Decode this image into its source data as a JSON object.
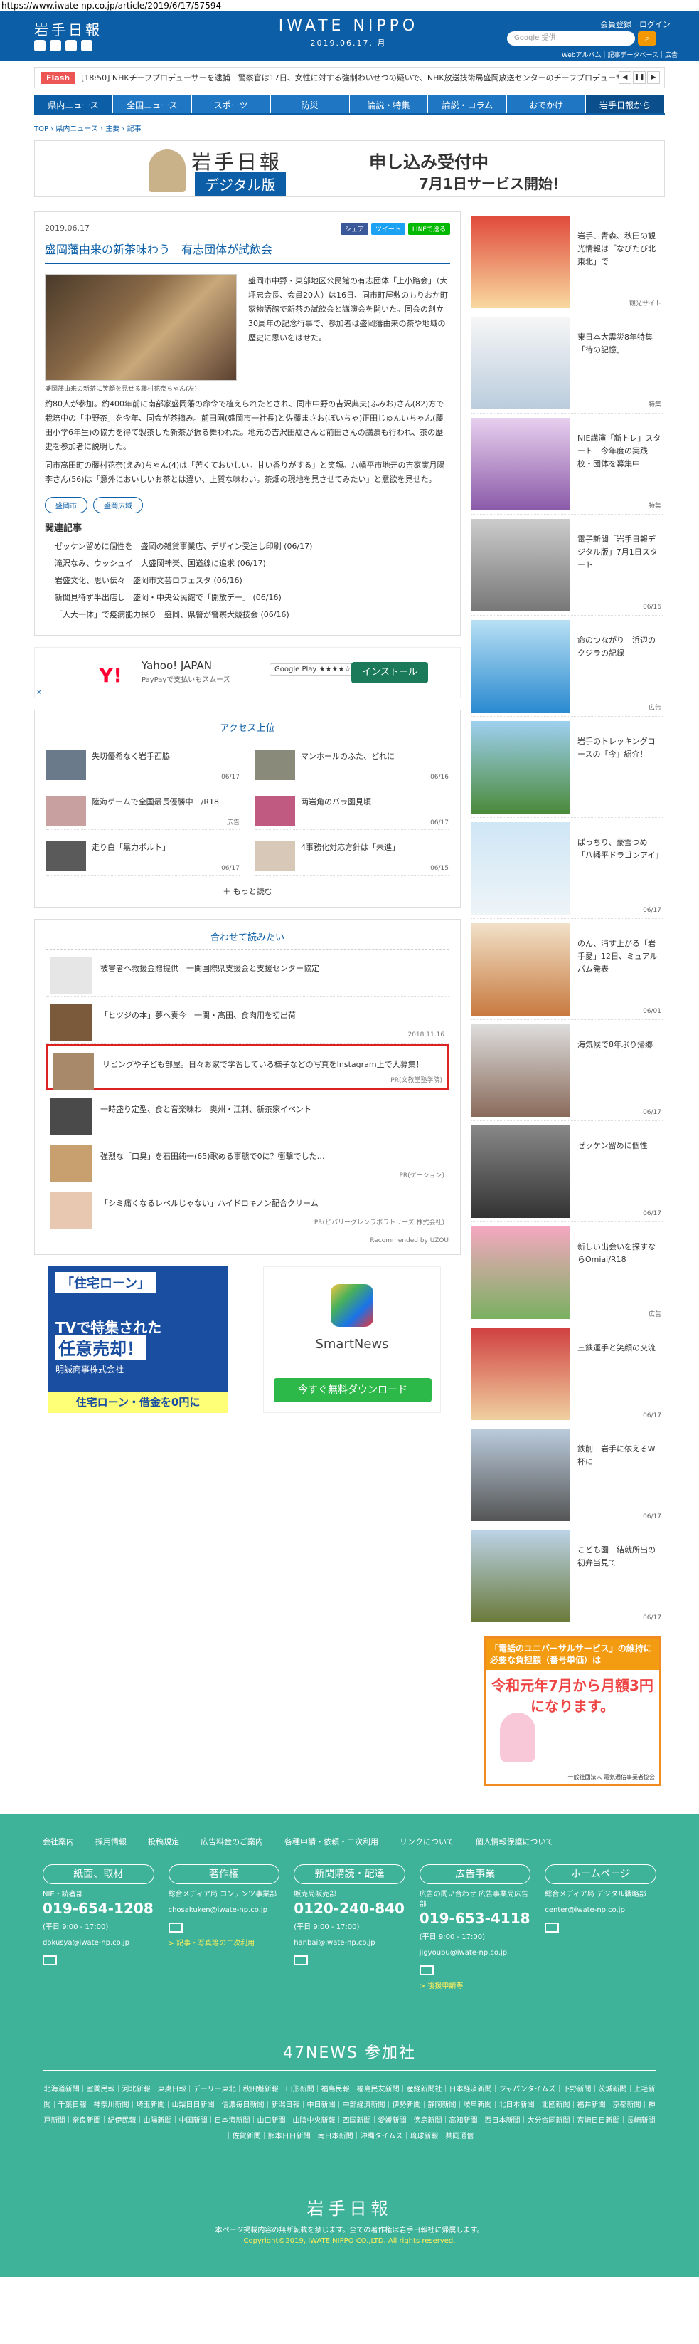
{
  "url": "https://www.iwate-np.co.jp/article/2019/6/17/57594",
  "header": {
    "logo_text": "岩手日報",
    "center_logo": "IWATE NIPPO",
    "center_date": "2019.06.17. 月",
    "member_links": "会員登録　ログイン",
    "search_placeholder": "Google 提供",
    "sublinks": "Webアルバム｜記事データベース｜広告"
  },
  "flash": {
    "label": "Flash",
    "text": "[18:50] NHKチーフプロデューサーを逮捕　警察官は17日、女性に対する強制わいせつの疑いで、NHK放送技術局盛岡放送センターのチーフプロデューサー..."
  },
  "nav": [
    "県内ニュース",
    "全国ニュース",
    "スポーツ",
    "防災",
    "論説・特集",
    "論説・コラム",
    "おでかけ",
    "岩手日報から"
  ],
  "breadcrumb": "TOP › 県内ニュース › 主要 › 記事",
  "banner": {
    "logo": "岩手日報",
    "digital": "デジタル版",
    "line1": "申し込み受付中",
    "line2": "7月1日サービス開始！"
  },
  "article": {
    "date": "2019.06.17",
    "share": [
      "シェア",
      "ツイート",
      "LINEで送る"
    ],
    "title": "盛岡藩由来の新茶味わう　有志団体が試飲会",
    "caption": "盛岡藩由来の新茶に笑顔を見せる藤村花奈ちゃん(左)",
    "p1": "盛岡市中野・東部地区公民館の有志団体「上小路会」（大坪忠会長、会員20人）は16日、同市町屋敷のもりおか町家物語館で新茶の試飲会と講演会を開いた。同会の創立30周年の記念行事で、参加者は盛岡藩由来の茶や地域の歴史に思いをはせた。",
    "p2": "約80人が参加。約400年前に南部家盛岡藩の命令で植えられたとされ、同市中野の吉沢典夫(ふみお)さん(82)方で栽培中の「中野茶」を今年、同会が茶摘み。前田園(盛岡市一社長)と佐藤まさお(ぼいちゃ)正田じゅんいちゃん(藤田小学6年生)の協力を得て製茶した新茶が振る舞われた。地元の吉沢田紘さんと前田さんの講演も行われ、茶の歴史を参加者に説明した。",
    "p3": "同市高田町の藤村花奈(えみ)ちゃん(4)は「苦くておいしい。甘い香りがする」と笑顔。八幡平市地元の吉家実月陽李さん(56)は「意外においしいお茶とは違い、上質な味わい。茶畑の現地を見させてみたい」と意欲を見せた。",
    "tags": [
      "盛岡市",
      "盛岡広域"
    ],
    "related_title": "関連記事",
    "related": [
      "ゼッケン留めに個性を　盛岡の雑貨事業店、デザイン受注し印刷 (06/17)",
      "滝沢なみ、ウッシュイ　大盛岡神楽、国道線に追求 (06/17)",
      "岩盛文化、思い伝々　盛岡市文芸ロフェスタ (06/16)",
      "新聞見待ず半出店し　盛岡・中央公民館で「開放デー」 (06/16)",
      "「人大一体」で疫病能力探り　盛岡、県警が警察犬競技会 (06/16)"
    ]
  },
  "ad_yahoo": {
    "brand": "Yahoo! JAPAN",
    "sub": "PayPayで支払いもスムーズ",
    "store": "Google Play ★★★★☆",
    "button": "インストール",
    "x": "×"
  },
  "ranking": {
    "title": "アクセス上位",
    "items": [
      {
        "text": "失切優希なく岩手西脇",
        "date": "06/17"
      },
      {
        "text": "マンホールのふた、どれに",
        "date": "06/16"
      },
      {
        "text": "陸海ゲームで全国最長優勝中　/R18",
        "date": "広告"
      },
      {
        "text": "两岩角のバラ園見頃",
        "date": "06/17"
      },
      {
        "text": "走り白「黒力ボルト」",
        "date": "06/17"
      },
      {
        "text": "4事務化対応方針は「未進」",
        "date": "06/15"
      }
    ],
    "more": "＋ もっと読む"
  },
  "recommend": {
    "title": "合わせて読みたい",
    "items": [
      {
        "text": "被害者へ救援金贈提供　一関国際県支援会と支援センター協定",
        "src": ""
      },
      {
        "text": "「ヒツジの本」夢へ奏今　一関・高田、食肉用を初出荷",
        "src": "2018.11.16"
      },
      {
        "text": "リビングや子ども部屋。日々お家で学習している様子などの写真をInstagram上で大募集！",
        "src": "PR(文教堂塾学院)"
      },
      {
        "text": "一時盛り定型、食と音楽味わ　奥州・江刺、新茶家イベント",
        "src": ""
      },
      {
        "text": "強烈な「口臭」を石田純一(65)歌める事態で0に？衝撃でした…",
        "src": "PR(ゲーション)"
      },
      {
        "text": "「シミ痛くなるレベルじゃない」ハイドロキノン配合クリーム",
        "src": "PR(ビバリーグレンラボラトリーズ 株式会社)"
      }
    ],
    "by": "Recommended by UZOU"
  },
  "ad_loan": {
    "l1": "「住宅ローン」",
    "l2": "TVで特集された",
    "l3": "任意売却！",
    "l4": "明誠商事株式会社",
    "l5": "住宅ローン・借金を0円に"
  },
  "ad_smart": {
    "name": "SmartNews",
    "button": "今すぐ無料ダウンロード"
  },
  "side": [
    {
      "text": "岩手、青森、秋田の観光情報は「なびたび北東北」で",
      "src": "観光サイト"
    },
    {
      "text": "東日本大震災8年特集「待の記憶」",
      "src": "特集"
    },
    {
      "text": "NIE講演「新トレ」スタート　今年度の実践校・団体を募集中",
      "src": "特集"
    },
    {
      "text": "電子新聞「岩手日報デジタル版」7月1日スタート",
      "src": "06/16"
    },
    {
      "text": "命のつながり　浜辺のクジラの記録",
      "src": "広告"
    },
    {
      "text": "岩手のトレッキングコースの「今」紹介！",
      "src": ""
    },
    {
      "text": "ぱっちり、豪雪つめ「八幡平ドラゴンアイ」",
      "src": "06/17"
    },
    {
      "text": "のん、消す上がる「岩手愛」12日、ミュアルバム発表",
      "src": "06/01"
    },
    {
      "text": "海気候で8年ぶり帰郷",
      "src": "06/17"
    },
    {
      "text": "ゼッケン留めに個性",
      "src": "06/17"
    },
    {
      "text": "新しい出会いを探すならOmiai/R18",
      "src": "広告"
    },
    {
      "text": "三鉄運手と笑顔の交流",
      "src": "06/17"
    },
    {
      "text": "鉄削　岩手に依えるW杯に",
      "src": "06/17"
    },
    {
      "text": "こども園　結就所出の初弁当見て",
      "src": "06/17"
    }
  ],
  "side_ad": {
    "head": "「電話のユニバーサルサービス」の維持に必要な負担額（番号単価）は",
    "big": "令和元年7月から月額3円になります。",
    "foot": "一般社団法人 電気通信事業者協会"
  },
  "footer": {
    "links": [
      "会社案内",
      "採用情報",
      "投稿規定",
      "広告料金のご案内",
      "各種申請・依頼・二次利用",
      "リンクについて",
      "個人情報保護について"
    ],
    "boxes": [
      {
        "head": "紙面、取材",
        "dept": "NIE・読者部",
        "phone": "019-654-1208",
        "hours": "(平日 9:00 - 17:00)",
        "mail": "dokusya@iwate-np.co.jp",
        "link": ""
      },
      {
        "head": "著作権",
        "dept": "総合メディア局 コンテンツ事業部",
        "phone": "",
        "hours": "",
        "mail": "chosakuken@iwate-np.co.jp",
        "link": "> 記事・写真等の二次利用"
      },
      {
        "head": "新聞購読・配達",
        "dept": "販売局販売部",
        "phone": "0120-240-840",
        "hours": "(平日 9:00 - 17:00)",
        "mail": "hanbai@iwate-np.co.jp",
        "link": ""
      },
      {
        "head": "広告事業",
        "dept": "広告の問い合わせ 広告事業局広告部",
        "phone": "019-653-4118",
        "hours": "(平日 9:00 - 17:00)",
        "mail": "jigyoubu@iwate-np.co.jp",
        "link": "> 後援申請等"
      },
      {
        "head": "ホームページ",
        "dept": "総合メディア局 デジタル戦略部",
        "phone": "",
        "hours": "",
        "mail": "center@iwate-np.co.jp",
        "link": ""
      }
    ],
    "n47": "47NEWS 参加社",
    "papers": "北海道新聞｜室蘭民報｜河北新報｜東奥日報｜デーリー東北｜秋田魁新報｜山形新聞｜福島民報｜福島民友新聞｜産経新聞社｜日本経済新聞｜ジャパンタイムズ｜下野新聞｜茨城新聞｜上毛新聞｜千葉日報｜神奈川新聞｜埼玉新聞｜山梨日日新聞｜信濃毎日新聞｜新潟日報｜中日新聞｜中部経済新聞｜伊勢新聞｜静岡新聞｜岐阜新聞｜北日本新聞｜北國新聞｜福井新聞｜京都新聞｜神戸新聞｜奈良新聞｜紀伊民報｜山陽新聞｜中国新聞｜日本海新聞｜山口新聞｜山陰中央新報｜四国新聞｜愛媛新聞｜徳島新聞｜高知新聞｜西日本新聞｜大分合同新聞｜宮崎日日新聞｜長崎新聞｜佐賀新聞｜熊本日日新聞｜南日本新聞｜沖縄タイムス｜琉球新報｜共同通信",
    "logo": "岩手日報",
    "note": "本ページ掲載内容の無断転載を禁じます。全ての著作権は岩手日報社に帰属します。",
    "copy": "Copyright©2019, IWATE NIPPO CO.,LTD. All rights reserved."
  },
  "colors": {
    "brand": "#0c5fa7",
    "footer": "#3fb39a",
    "highlight": "#dd2222"
  }
}
